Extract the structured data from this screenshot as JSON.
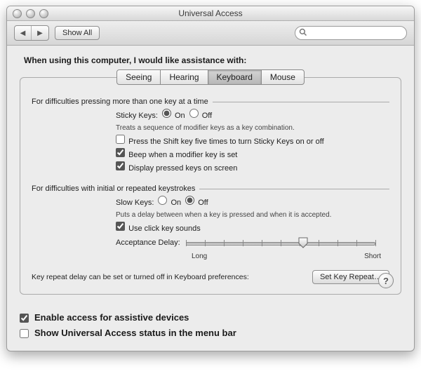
{
  "window": {
    "title": "Universal Access"
  },
  "toolbar": {
    "show_all": "Show All",
    "search_placeholder": ""
  },
  "heading": "When using this computer, I would like assistance with:",
  "tabs": [
    "Seeing",
    "Hearing",
    "Keyboard",
    "Mouse"
  ],
  "active_tab": 2,
  "section1": {
    "title": "For difficulties pressing more than one key at a time",
    "sticky_label": "Sticky Keys:",
    "on": "On",
    "off": "Off",
    "sticky_value": "on",
    "hint": "Treats a sequence of modifier keys as a key combination.",
    "opt_shift5": "Press the Shift key five times to turn Sticky Keys on or off",
    "opt_shift5_checked": false,
    "opt_beep": "Beep when a modifier key is set",
    "opt_beep_checked": true,
    "opt_display": "Display pressed keys on screen",
    "opt_display_checked": true
  },
  "section2": {
    "title": "For difficulties with initial or repeated keystrokes",
    "slow_label": "Slow Keys:",
    "on": "On",
    "off": "Off",
    "slow_value": "off",
    "hint": "Puts a delay between when a key is pressed and when it is accepted.",
    "opt_click": "Use click key sounds",
    "opt_click_checked": true,
    "delay_label": "Acceptance Delay:",
    "delay_long": "Long",
    "delay_short": "Short",
    "delay_pct": 62
  },
  "footer": {
    "note": "Key repeat delay can be set or turned off in Keyboard preferences:",
    "button": "Set Key Repeat…"
  },
  "bottom": {
    "assistive": "Enable access for assistive devices",
    "assistive_checked": true,
    "menubar": "Show Universal Access status in the menu bar",
    "menubar_checked": false
  }
}
